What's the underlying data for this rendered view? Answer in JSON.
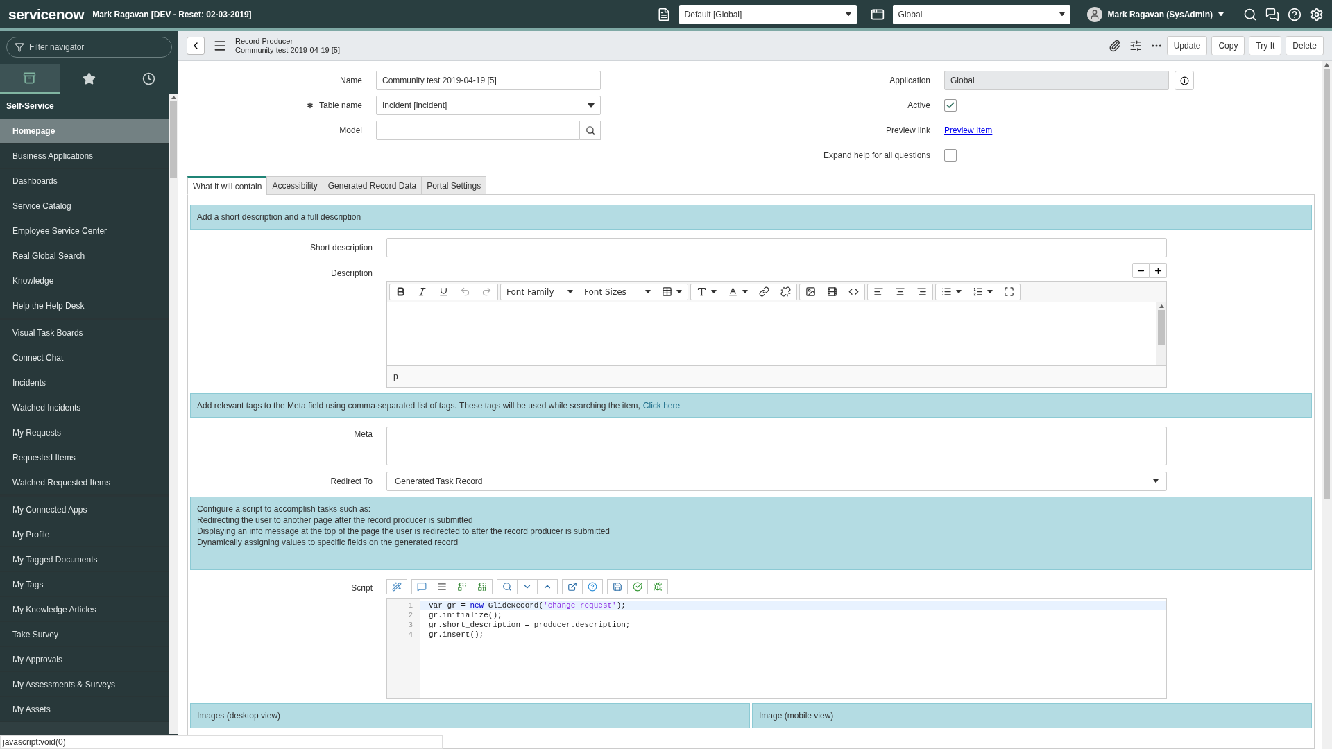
{
  "header": {
    "logo": "servicenow",
    "instance": "Mark Ragavan [DEV - Reset: 02-03-2019]",
    "update_set": "Default [Global]",
    "scope": "Global",
    "user": "Mark Ragavan (SysAdmin)"
  },
  "sidebar": {
    "filter_placeholder": "Filter navigator",
    "tabs": [
      {
        "kind": "all",
        "selected": true
      },
      {
        "kind": "favorites",
        "selected": false
      },
      {
        "kind": "history",
        "selected": false
      }
    ],
    "section": "Self-Service",
    "groups": [
      {
        "items": [
          {
            "label": "Homepage",
            "selected": true
          },
          {
            "label": "Business Applications",
            "selected": false
          },
          {
            "label": "Dashboards",
            "selected": false
          },
          {
            "label": "Service Catalog",
            "selected": false
          },
          {
            "label": "Employee Service Center",
            "selected": false
          },
          {
            "label": "Real Global Search",
            "selected": false
          },
          {
            "label": "Knowledge",
            "selected": false
          },
          {
            "label": "Help the Help Desk",
            "selected": false
          }
        ]
      },
      {
        "items": [
          {
            "label": "Visual Task Boards",
            "selected": false
          },
          {
            "label": "Connect Chat",
            "selected": false
          },
          {
            "label": "Incidents",
            "selected": false
          },
          {
            "label": "Watched Incidents",
            "selected": false
          },
          {
            "label": "My Requests",
            "selected": false
          },
          {
            "label": "Requested Items",
            "selected": false
          },
          {
            "label": "Watched Requested Items",
            "selected": false
          }
        ]
      },
      {
        "items": [
          {
            "label": "My Connected Apps",
            "selected": false
          },
          {
            "label": "My Profile",
            "selected": false
          },
          {
            "label": "My Tagged Documents",
            "selected": false
          },
          {
            "label": "My Tags",
            "selected": false
          },
          {
            "label": "My Knowledge Articles",
            "selected": false
          },
          {
            "label": "Take Survey",
            "selected": false
          },
          {
            "label": "My Approvals",
            "selected": false
          },
          {
            "label": "My Assessments & Surveys",
            "selected": false
          },
          {
            "label": "My Assets",
            "selected": false
          }
        ]
      }
    ]
  },
  "record_header": {
    "table": "Record Producer",
    "record": "Community test 2019-04-19 [5]",
    "buttons": [
      "Update",
      "Copy",
      "Try It",
      "Delete"
    ]
  },
  "form": {
    "name": {
      "label": "Name",
      "value": "Community test 2019-04-19 [5]"
    },
    "table_name": {
      "label": "Table name",
      "value": "Incident [incident]",
      "mandatory": true
    },
    "model": {
      "label": "Model"
    },
    "application": {
      "label": "Application",
      "value": "Global"
    },
    "active": {
      "label": "Active",
      "checked": true
    },
    "preview_link": {
      "label": "Preview link",
      "link": "Preview Item"
    },
    "expand_help": {
      "label": "Expand help for all questions",
      "checked": false
    }
  },
  "tabs": [
    {
      "label": "What it will contain",
      "selected": true
    },
    {
      "label": "Accessibility",
      "selected": false
    },
    {
      "label": "Generated Record Data",
      "selected": false
    },
    {
      "label": "Portal Settings",
      "selected": false
    }
  ],
  "section": {
    "banner": "Add a short description and a full description",
    "short_description": {
      "label": "Short description"
    },
    "description": {
      "label": "Description",
      "font_family": "Font Family",
      "font_sizes": "Font Sizes",
      "path": "p",
      "toolbar": [
        {
          "buttons": [
            {
              "kind": "bold"
            },
            {
              "kind": "italic"
            },
            {
              "kind": "underline"
            },
            {
              "kind": "undo"
            },
            {
              "kind": "redo"
            }
          ]
        },
        {
          "buttons": [
            {
              "kind": "font_family"
            },
            {
              "kind": "font_sizes"
            },
            {
              "kind": "table"
            }
          ]
        },
        {
          "buttons": [
            {
              "kind": "text_color"
            },
            {
              "kind": "bg_color"
            },
            {
              "kind": "link"
            },
            {
              "kind": "unlink"
            }
          ]
        },
        {
          "buttons": [
            {
              "kind": "image"
            },
            {
              "kind": "media"
            },
            {
              "kind": "code"
            }
          ]
        },
        {
          "buttons": [
            {
              "kind": "align_left"
            },
            {
              "kind": "align_center"
            },
            {
              "kind": "align_right"
            }
          ]
        },
        {
          "buttons": [
            {
              "kind": "bullets"
            },
            {
              "kind": "numbers"
            },
            {
              "kind": "fullscreen"
            }
          ]
        }
      ]
    },
    "meta_banner": "Add relevant tags to the Meta field using comma-separated list of tags. These tags will be used while searching the item,",
    "meta_banner_link": "Click here",
    "meta": {
      "label": "Meta"
    },
    "redirect": {
      "label": "Redirect To",
      "value": "Generated Task Record"
    },
    "script_banner": [
      "Configure a script to accomplish tasks such as:",
      "Redirecting the user to another page after the record producer is submitted",
      "Displaying an info message at the top of the page the user is redirected to after the record producer is submitted",
      "Dynamically assigning values to specific fields on the generated record"
    ],
    "script": {
      "label": "Script",
      "toolbar": [
        {
          "buttons": [
            {
              "kind": "format"
            }
          ]
        },
        {
          "buttons": [
            {
              "kind": "comment"
            },
            {
              "kind": "block"
            },
            {
              "kind": "replace"
            },
            {
              "kind": "replace_all"
            }
          ]
        },
        {
          "buttons": [
            {
              "kind": "search"
            },
            {
              "kind": "down"
            },
            {
              "kind": "up"
            }
          ]
        },
        {
          "buttons": [
            {
              "kind": "expand"
            },
            {
              "kind": "help"
            }
          ]
        },
        {
          "buttons": [
            {
              "kind": "save"
            },
            {
              "kind": "check"
            },
            {
              "kind": "debug"
            }
          ]
        }
      ],
      "lines": [
        {
          "number": "1",
          "segments": [
            {
              "kind": "plain",
              "text": "var gr = "
            },
            {
              "kind": "keyword",
              "text": "new"
            },
            {
              "kind": "plain",
              "text": " GlideRecord("
            },
            {
              "kind": "string",
              "text": "'change_request'"
            },
            {
              "kind": "plain",
              "text": ");"
            }
          ]
        },
        {
          "number": "2",
          "segments": [
            {
              "kind": "plain",
              "text": "gr.initialize();"
            }
          ]
        },
        {
          "number": "3",
          "segments": [
            {
              "kind": "plain",
              "text": "gr.short_description = producer.description;"
            }
          ]
        },
        {
          "number": "4",
          "segments": [
            {
              "kind": "plain",
              "text": "gr.insert();"
            }
          ]
        }
      ]
    },
    "image_banners": [
      "Images (desktop view)",
      "Image (mobile view)"
    ]
  },
  "status_bar": "javascript:void(0)"
}
